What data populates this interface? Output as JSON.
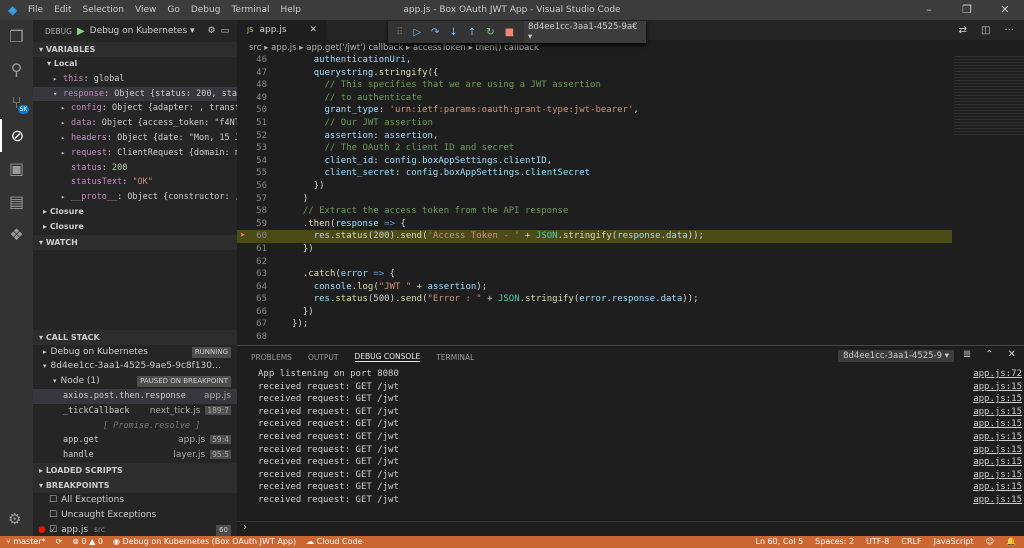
{
  "window": {
    "title": "app.js - Box OAuth JWT App - Visual Studio Code",
    "menu": [
      "File",
      "Edit",
      "Selection",
      "View",
      "Go",
      "Debug",
      "Terminal",
      "Help"
    ]
  },
  "activity": [
    {
      "icon": "files-icon",
      "g": "❐"
    },
    {
      "icon": "search-icon",
      "g": "⚲"
    },
    {
      "icon": "source-control-icon",
      "g": "⑂",
      "badge": "SK"
    },
    {
      "icon": "debug-icon",
      "g": "⊘"
    },
    {
      "icon": "extensions-icon",
      "g": "▣"
    },
    {
      "icon": "docker-icon",
      "g": "▤"
    },
    {
      "icon": "kubernetes-icon",
      "g": "❖"
    }
  ],
  "debug": {
    "label": "DEBUG",
    "config": "Debug on Kubernetes ▾"
  },
  "variables": {
    "header": "VARIABLES",
    "local": "Local",
    "items": [
      {
        "ind": 20,
        "arrow": "▸",
        "k": "this",
        "v": "global"
      },
      {
        "ind": 20,
        "arrow": "▾",
        "k": "response",
        "v": "Object {status: 200, statu…"
      },
      {
        "ind": 28,
        "arrow": "▸",
        "k": "config",
        "v": "Object {adapter: , transfor…"
      },
      {
        "ind": 28,
        "arrow": "▸",
        "k": "data",
        "v": "Object {access_token: \"f4NTiO…"
      },
      {
        "ind": 28,
        "arrow": "▸",
        "k": "headers",
        "v": "Object {date: \"Mon, 15 Jul…"
      },
      {
        "ind": 28,
        "arrow": "▸",
        "k": "request",
        "v": "ClientRequest {domain: nul…"
      },
      {
        "ind": 28,
        "arrow": "",
        "k": "status",
        "v": "200",
        "t": "n"
      },
      {
        "ind": 28,
        "arrow": "",
        "k": "statusText",
        "v": "\"OK\"",
        "t": "s"
      },
      {
        "ind": 28,
        "arrow": "▸",
        "k": "__proto__",
        "v": "Object {constructor: , _…"
      }
    ],
    "closures": [
      "Closure",
      "Closure"
    ]
  },
  "watch": {
    "header": "WATCH"
  },
  "callstack": {
    "header": "CALL STACK",
    "sessions": [
      {
        "name": "Debug on Kubernetes",
        "state": "RUNNING",
        "arrow": "▸"
      },
      {
        "name": "8d4ee1cc-3aa1-4525-9ae5-9c8f130…",
        "state": "PAUSED",
        "arrow": "▾"
      }
    ],
    "node": {
      "name": "Node (1)",
      "state": "PAUSED ON BREAKPOINT"
    },
    "frames": [
      {
        "fn": "axios.post.then.response",
        "file": "app.js",
        "pos": ""
      },
      {
        "fn": "_tickCallback",
        "file": "next_tick.js",
        "pos": "189:7"
      },
      {
        "fn": "[ Promise.resolve ]",
        "file": "",
        "pos": "",
        "async": true
      },
      {
        "fn": "app.get",
        "file": "app.js",
        "pos": "59:4"
      },
      {
        "fn": "handle",
        "file": "layer.js",
        "pos": "95:5"
      }
    ]
  },
  "loaded_scripts": {
    "header": "LOADED SCRIPTS"
  },
  "breakpoints": {
    "header": "BREAKPOINTS",
    "items": [
      {
        "label": "All Exceptions",
        "checked": false
      },
      {
        "label": "Uncaught Exceptions",
        "checked": false
      },
      {
        "label": "app.js",
        "path": "src",
        "line": "60",
        "checked": true
      }
    ]
  },
  "editor": {
    "tab": "app.js",
    "breadcrumb": [
      "src",
      "app.js",
      "app.get('/jwt') callback",
      "accessToken",
      "then() callback"
    ],
    "debug_toolbar": {
      "icons": [
        "continue-icon",
        "step-over-icon",
        "step-into-icon",
        "step-out-icon",
        "restart-icon",
        "stop-icon"
      ],
      "session": "8d4ee1cc-3aa1-4525-9a€ ▾"
    },
    "current_line": 60,
    "lines": [
      {
        "n": "46",
        "t": [
          [
            "p",
            "    "
          ],
          [
            "id",
            "authenticationUri"
          ],
          [
            "p",
            ","
          ]
        ]
      },
      {
        "n": "47",
        "t": [
          [
            "p",
            "    "
          ],
          [
            "id",
            "querystring"
          ],
          [
            "p",
            "."
          ],
          [
            "fn",
            "stringify"
          ],
          [
            "p",
            "({"
          ]
        ]
      },
      {
        "n": "48",
        "t": [
          [
            "p",
            "      "
          ],
          [
            "cm",
            "// This specifies that we are using a JWT assertion"
          ]
        ]
      },
      {
        "n": "49",
        "t": [
          [
            "p",
            "      "
          ],
          [
            "cm",
            "// to authenticate"
          ]
        ]
      },
      {
        "n": "50",
        "t": [
          [
            "p",
            "      "
          ],
          [
            "id",
            "grant_type"
          ],
          [
            "p",
            ": "
          ],
          [
            "str",
            "'urn:ietf:params:oauth:grant-type:jwt-bearer'"
          ],
          [
            "p",
            ","
          ]
        ]
      },
      {
        "n": "51",
        "t": [
          [
            "p",
            "      "
          ],
          [
            "cm",
            "// Our JWT assertion"
          ]
        ]
      },
      {
        "n": "52",
        "t": [
          [
            "p",
            "      "
          ],
          [
            "id",
            "assertion"
          ],
          [
            "p",
            ": "
          ],
          [
            "id",
            "assertion"
          ],
          [
            "p",
            ","
          ]
        ]
      },
      {
        "n": "53",
        "t": [
          [
            "p",
            "      "
          ],
          [
            "cm",
            "// The OAuth 2 client ID and secret"
          ]
        ]
      },
      {
        "n": "54",
        "t": [
          [
            "p",
            "      "
          ],
          [
            "id",
            "client_id"
          ],
          [
            "p",
            ": "
          ],
          [
            "id",
            "config"
          ],
          [
            "p",
            "."
          ],
          [
            "id",
            "boxAppSettings"
          ],
          [
            "p",
            "."
          ],
          [
            "id",
            "clientID"
          ],
          [
            "p",
            ","
          ]
        ]
      },
      {
        "n": "55",
        "t": [
          [
            "p",
            "      "
          ],
          [
            "id",
            "client_secret"
          ],
          [
            "p",
            ": "
          ],
          [
            "id",
            "config"
          ],
          [
            "p",
            "."
          ],
          [
            "id",
            "boxAppSettings"
          ],
          [
            "p",
            "."
          ],
          [
            "id",
            "clientSecret"
          ]
        ]
      },
      {
        "n": "56",
        "t": [
          [
            "p",
            "    })"
          ]
        ]
      },
      {
        "n": "57",
        "t": [
          [
            "p",
            "  )"
          ]
        ]
      },
      {
        "n": "58",
        "t": [
          [
            "p",
            "  "
          ],
          [
            "cm",
            "// Extract the access token from the API response"
          ]
        ]
      },
      {
        "n": "59",
        "t": [
          [
            "p",
            "  ."
          ],
          [
            "fn",
            "then"
          ],
          [
            "p",
            "("
          ],
          [
            "id",
            "response"
          ],
          [
            "p",
            " "
          ],
          [
            "kw",
            "=>"
          ],
          [
            "p",
            " {"
          ]
        ]
      },
      {
        "n": "60",
        "t": [
          [
            "p",
            "    "
          ],
          [
            "id",
            "res"
          ],
          [
            "p",
            "."
          ],
          [
            "fn",
            "status"
          ],
          [
            "p",
            "(200)."
          ],
          [
            "fn",
            "send"
          ],
          [
            "p",
            "("
          ],
          [
            "str",
            "'Access Token - '"
          ],
          [
            "p",
            " + "
          ],
          [
            "cls",
            "JSON"
          ],
          [
            "p",
            "."
          ],
          [
            "fn",
            "stringify"
          ],
          [
            "p",
            "("
          ],
          [
            "id",
            "response"
          ],
          [
            "p",
            "."
          ],
          [
            "id",
            "data"
          ],
          [
            "p",
            "));"
          ]
        ]
      },
      {
        "n": "61",
        "t": [
          [
            "p",
            "  })"
          ]
        ]
      },
      {
        "n": "62",
        "t": [
          [
            "p",
            ""
          ]
        ]
      },
      {
        "n": "63",
        "t": [
          [
            "p",
            "  ."
          ],
          [
            "fn",
            "catch"
          ],
          [
            "p",
            "("
          ],
          [
            "id",
            "error"
          ],
          [
            "p",
            " "
          ],
          [
            "kw",
            "=>"
          ],
          [
            "p",
            " {"
          ]
        ]
      },
      {
        "n": "64",
        "t": [
          [
            "p",
            "    "
          ],
          [
            "id",
            "console"
          ],
          [
            "p",
            "."
          ],
          [
            "fn",
            "log"
          ],
          [
            "p",
            "("
          ],
          [
            "str",
            "\"JWT \""
          ],
          [
            "p",
            " + "
          ],
          [
            "id",
            "assertion"
          ],
          [
            "p",
            ");"
          ]
        ]
      },
      {
        "n": "65",
        "t": [
          [
            "p",
            "    "
          ],
          [
            "id",
            "res"
          ],
          [
            "p",
            "."
          ],
          [
            "fn",
            "status"
          ],
          [
            "p",
            "(500)."
          ],
          [
            "fn",
            "send"
          ],
          [
            "p",
            "("
          ],
          [
            "str",
            "\"Error : \""
          ],
          [
            "p",
            " + "
          ],
          [
            "cls",
            "JSON"
          ],
          [
            "p",
            "."
          ],
          [
            "fn",
            "stringify"
          ],
          [
            "p",
            "("
          ],
          [
            "id",
            "error"
          ],
          [
            "p",
            "."
          ],
          [
            "id",
            "response"
          ],
          [
            "p",
            "."
          ],
          [
            "id",
            "data"
          ],
          [
            "p",
            "));"
          ]
        ]
      },
      {
        "n": "66",
        "t": [
          [
            "p",
            "  })"
          ]
        ]
      },
      {
        "n": "67",
        "t": [
          [
            "p",
            "});"
          ]
        ]
      },
      {
        "n": "68",
        "t": [
          [
            "p",
            ""
          ]
        ]
      }
    ]
  },
  "panel": {
    "tabs": [
      "PROBLEMS",
      "OUTPUT",
      "DEBUG CONSOLE",
      "TERMINAL"
    ],
    "active": 2,
    "session": "8d4ee1cc-3aa1-4525-9 ▾",
    "lines": [
      {
        "text": "App listening on port 8080",
        "src": "app.js:72"
      },
      {
        "text": "received request: GET /jwt",
        "src": "app.js:15"
      },
      {
        "text": "received request: GET /jwt",
        "src": "app.js:15"
      },
      {
        "text": "received request: GET /jwt",
        "src": "app.js:15"
      },
      {
        "text": "received request: GET /jwt",
        "src": "app.js:15"
      },
      {
        "text": "received request: GET /jwt",
        "src": "app.js:15"
      },
      {
        "text": "received request: GET /jwt",
        "src": "app.js:15"
      },
      {
        "text": "received request: GET /jwt",
        "src": "app.js:15"
      },
      {
        "text": "received request: GET /jwt",
        "src": "app.js:15"
      },
      {
        "text": "received request: GET /jwt",
        "src": "app.js:15"
      },
      {
        "text": "received request: GET /jwt",
        "src": "app.js:15"
      }
    ],
    "prompt": "›"
  },
  "status": {
    "branch": "master*",
    "errors": "0",
    "warnings": "0",
    "debug": "Debug on Kubernetes (Box OAuth JWT App)",
    "cloud": "Cloud Code",
    "position": "Ln 60, Col 5",
    "spaces": "Spaces: 2",
    "encoding": "UTF-8",
    "eol": "CRLF",
    "language": "JavaScript"
  },
  "colors": {
    "statusbar": "#cc6633",
    "current_line": "#4b4b18",
    "breakpoint": "#e51400"
  }
}
